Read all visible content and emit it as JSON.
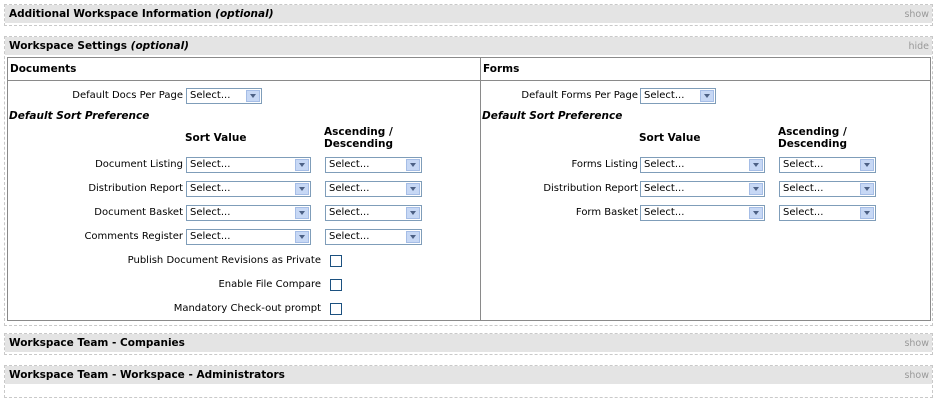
{
  "sections": {
    "additional": {
      "title": "Additional Workspace Information",
      "optional": "(optional)",
      "toggle": "show"
    },
    "settings": {
      "title": "Workspace Settings",
      "optional": "(optional)",
      "toggle": "hide"
    },
    "companies": {
      "title": "Workspace Team - Companies",
      "toggle": "show"
    },
    "administrators": {
      "title": "Workspace Team - Workspace - Administrators",
      "toggle": "show"
    }
  },
  "documents": {
    "header": "Documents",
    "per_page_label": "Default Docs Per Page",
    "per_page_value": "Select...",
    "sort_title": "Default Sort Preference",
    "sort_value_header": "Sort Value",
    "asc_desc_header_1": "Ascending /",
    "asc_desc_header_2": "Descending",
    "rows": [
      {
        "label": "Document Listing",
        "sort": "Select...",
        "order": "Select..."
      },
      {
        "label": "Distribution Report",
        "sort": "Select...",
        "order": "Select..."
      },
      {
        "label": "Document Basket",
        "sort": "Select...",
        "order": "Select..."
      },
      {
        "label": "Comments Register",
        "sort": "Select...",
        "order": "Select..."
      }
    ],
    "checkboxes": [
      {
        "label": "Publish Document Revisions as Private",
        "checked": false
      },
      {
        "label": "Enable File Compare",
        "checked": false
      },
      {
        "label": "Mandatory Check-out prompt",
        "checked": false
      }
    ]
  },
  "forms": {
    "header": "Forms",
    "per_page_label": "Default Forms Per Page",
    "per_page_value": "Select...",
    "sort_title": "Default Sort Preference",
    "sort_value_header": "Sort Value",
    "asc_desc_header_1": "Ascending /",
    "asc_desc_header_2": "Descending",
    "rows": [
      {
        "label": "Forms Listing",
        "sort": "Select...",
        "order": "Select..."
      },
      {
        "label": "Distribution Report",
        "sort": "Select...",
        "order": "Select..."
      },
      {
        "label": "Form Basket",
        "sort": "Select...",
        "order": "Select..."
      }
    ]
  },
  "icons": {
    "dropdown": "chevron-down-icon"
  },
  "colors": {
    "section_header_bg": "#e4e4e4",
    "toggle_text": "#999999",
    "select_border": "#7f9db9",
    "select_arrow": "#c7d8f5"
  }
}
